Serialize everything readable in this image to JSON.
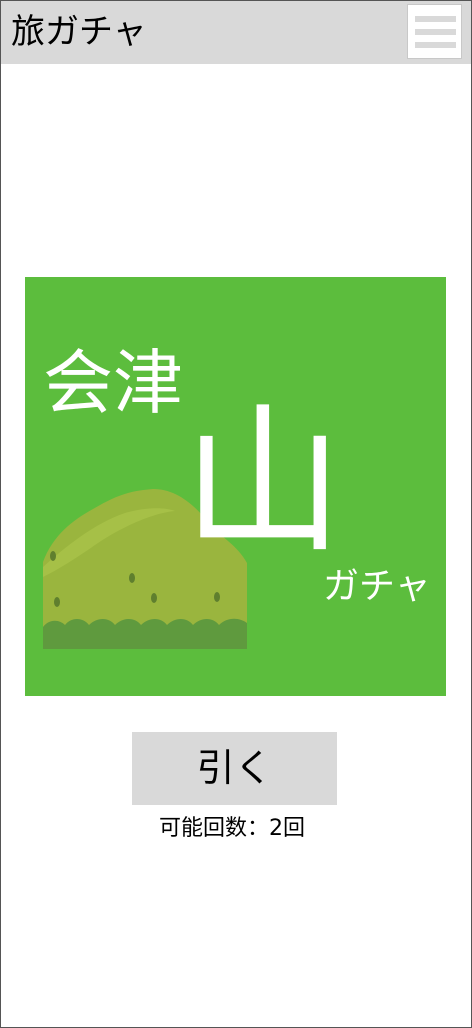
{
  "header": {
    "title": "旅ガチャ",
    "menu_icon": "hamburger-menu-icon"
  },
  "banner": {
    "region": "会津",
    "category": "山",
    "suffix": "ガチャ",
    "background_color": "#5cbd3d",
    "illustration": "mountain-illustration"
  },
  "draw": {
    "button_label": "引く",
    "remaining_label": "可能回数：2回"
  },
  "colors": {
    "header_bg": "#d9d9d9",
    "button_bg": "#d9d9d9",
    "mountain_fill": "#9ab53e",
    "mountain_bushes": "#5f9a3e"
  }
}
